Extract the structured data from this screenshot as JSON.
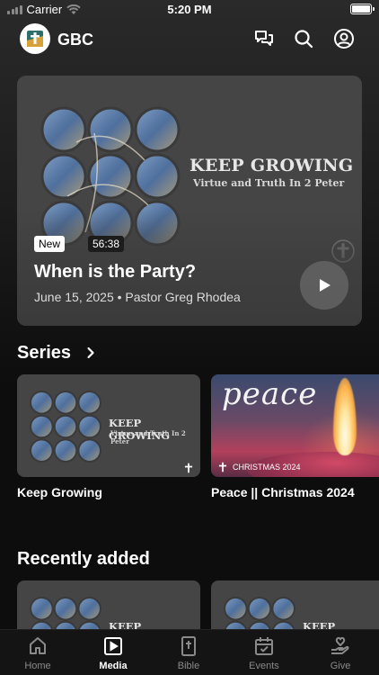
{
  "status_bar": {
    "carrier": "Carrier",
    "time": "5:20 PM"
  },
  "header": {
    "brand": "GBC",
    "icons": [
      "chat-icon",
      "search-icon",
      "profile-icon"
    ]
  },
  "hero": {
    "art_title": "KEEP GROWING",
    "art_subtitle": "Virtue and Truth In 2 Peter",
    "badge_new": "New",
    "duration": "56:38",
    "title": "When is the Party?",
    "meta": "June 15, 2025 • Pastor Greg Rhodea"
  },
  "series": {
    "heading": "Series",
    "items": [
      {
        "label": "Keep Growing",
        "art_title": "KEEP GROWING",
        "art_subtitle": "Virtue and Truth In 2 Peter"
      },
      {
        "label": "Peace || Christmas 2024",
        "art_word": "peace",
        "art_tag": "CHRISTMAS 2024"
      }
    ]
  },
  "recent": {
    "heading": "Recently added",
    "items": [
      {
        "art_title": "KEEP GROWING"
      },
      {
        "art_title": "KEEP GROWIN"
      }
    ]
  },
  "tabs": [
    {
      "label": "Home",
      "icon": "home-icon"
    },
    {
      "label": "Media",
      "icon": "media-icon"
    },
    {
      "label": "Bible",
      "icon": "bible-icon"
    },
    {
      "label": "Events",
      "icon": "events-icon"
    },
    {
      "label": "Give",
      "icon": "give-icon"
    }
  ],
  "colors": {
    "background": "#0d0d0d",
    "card": "#454545",
    "tab_active": "#ffffff",
    "tab_inactive": "#8a8a8a"
  }
}
